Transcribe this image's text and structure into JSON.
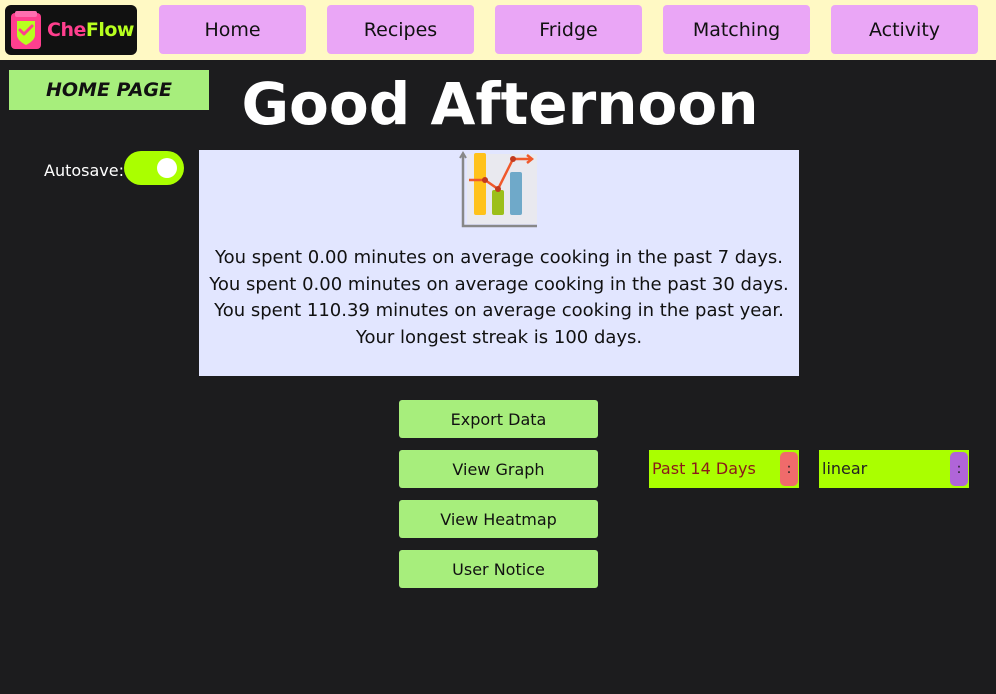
{
  "app": {
    "logo_che": "Che",
    "logo_flow": "Flow"
  },
  "nav": {
    "items": [
      {
        "label": "Home"
      },
      {
        "label": "Recipes"
      },
      {
        "label": "Fridge"
      },
      {
        "label": "Matching"
      },
      {
        "label": "Activity"
      }
    ]
  },
  "page": {
    "label": "HOME PAGE",
    "greeting": "Good Afternoon"
  },
  "autosave": {
    "label": "Autosave:",
    "enabled": true,
    "icon": "toggle-switch"
  },
  "stats": {
    "icon": "bar-chart-icon",
    "lines": [
      "You spent 0.00 minutes on average cooking in the past 7 days.",
      "You spent 0.00 minutes on average cooking in the past 30 days.",
      "You spent 110.39 minutes on average cooking in the past year.",
      "Your longest streak is 100 days."
    ]
  },
  "actions": {
    "export": "Export Data",
    "graph": "View Graph",
    "heatmap": "View Heatmap",
    "notice": "User Notice"
  },
  "selects": {
    "range": {
      "value": "Past 14 Days",
      "handle": ":"
    },
    "scale": {
      "value": "linear",
      "handle": ":"
    }
  },
  "colors": {
    "topbar": "#fff9c4",
    "nav_button": "#eaa6f6",
    "green_button": "#a7ee7c",
    "lime": "#aaff00",
    "card": "#e2e6ff",
    "background": "#1c1c1e",
    "range_handle": "#f06b6b",
    "scale_handle": "#b065d8"
  }
}
